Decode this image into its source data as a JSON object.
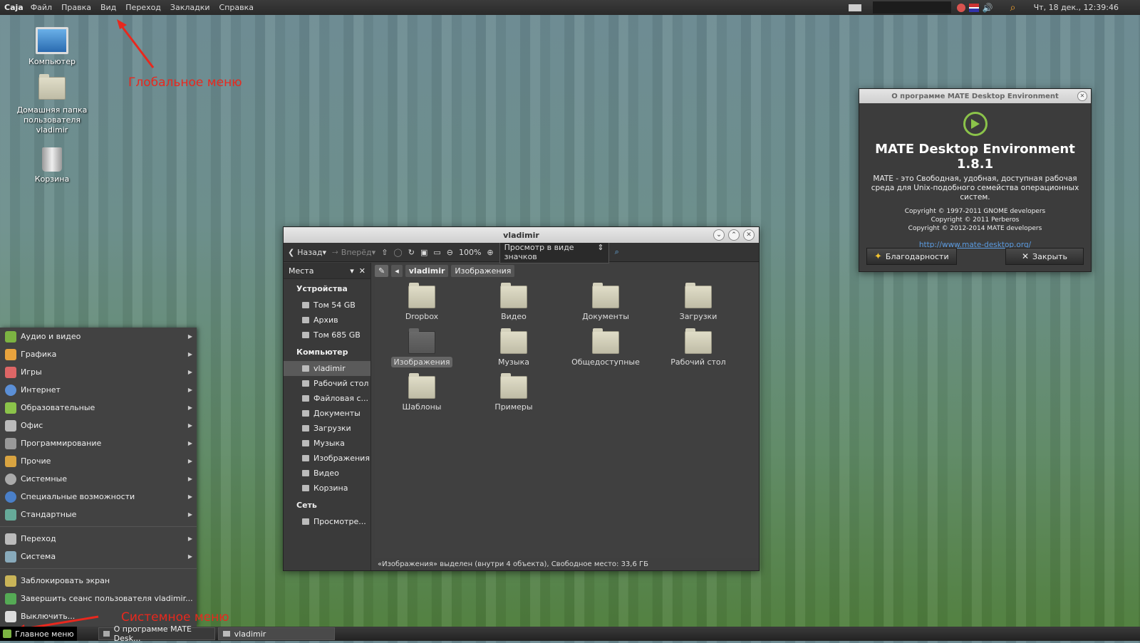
{
  "topbar": {
    "app_name": "Caja",
    "menu": [
      "Файл",
      "Правка",
      "Вид",
      "Переход",
      "Закладки",
      "Справка"
    ],
    "clock": "Чт, 18 дек., 12:39:46"
  },
  "desktop": {
    "icons": [
      {
        "label": "Компьютер",
        "icon": "computer-icon"
      },
      {
        "label": "Домашняя папка пользователя vladimir",
        "icon": "home-folder-icon"
      },
      {
        "label": "Корзина",
        "icon": "trash-icon"
      }
    ]
  },
  "annotations": {
    "global_menu": "Глобальное меню",
    "system_menu": "Системное меню",
    "color": "#e8281e"
  },
  "file_manager": {
    "title": "vladimir",
    "toolbar": {
      "back": "Назад",
      "forward": "Вперёд",
      "zoom": "100%",
      "view_mode": "Просмотр в виде значков"
    },
    "sidebar": {
      "header": "Места",
      "devices_title": "Устройства",
      "devices": [
        "Том 54 GB",
        "Архив",
        "Том 685 GB"
      ],
      "computer_title": "Компьютер",
      "computer": [
        "vladimir",
        "Рабочий стол",
        "Файловая с...",
        "Документы",
        "Загрузки",
        "Музыка",
        "Изображения",
        "Видео",
        "Корзина"
      ],
      "network_title": "Сеть",
      "network": [
        "Просмотре..."
      ]
    },
    "path": [
      "vladimir",
      "Изображения"
    ],
    "files": [
      "Dropbox",
      "Видео",
      "Документы",
      "Загрузки",
      "Изображения",
      "Музыка",
      "Общедоступные",
      "Рабочий стол",
      "Шаблоны",
      "Примеры"
    ],
    "selected_file": "Изображения",
    "status": "«Изображения» выделен (внутри 4 объекта), Свободное место: 33,6 ГБ"
  },
  "about": {
    "title": "О программе MATE Desktop Environment",
    "heading": "MATE Desktop Environment 1.8.1",
    "description": "MATE - это Свободная, удобная, доступная рабочая среда для Unix-подобного семейства операционных систем.",
    "copyright": [
      "Copyright © 1997-2011 GNOME developers",
      "Copyright © 2011 Perberos",
      "Copyright © 2012-2014 MATE developers"
    ],
    "link": "http://www.mate-desktop.org/",
    "thanks_button": "Благодарности",
    "close_button": "Закрыть"
  },
  "main_menu": {
    "categories": [
      "Аудио и видео",
      "Графика",
      "Игры",
      "Интернет",
      "Образовательные",
      "Офис",
      "Программирование",
      "Прочие",
      "Системные",
      "Специальные возможности",
      "Стандартные"
    ],
    "places": [
      "Переход",
      "Система"
    ],
    "actions": [
      "Заблокировать экран",
      "Завершить сеанс пользователя vladimir...",
      "Выключить..."
    ]
  },
  "taskbar": {
    "main_menu": "Главное меню",
    "tasks": [
      "О программе MATE Desk...",
      "vladimir"
    ]
  }
}
